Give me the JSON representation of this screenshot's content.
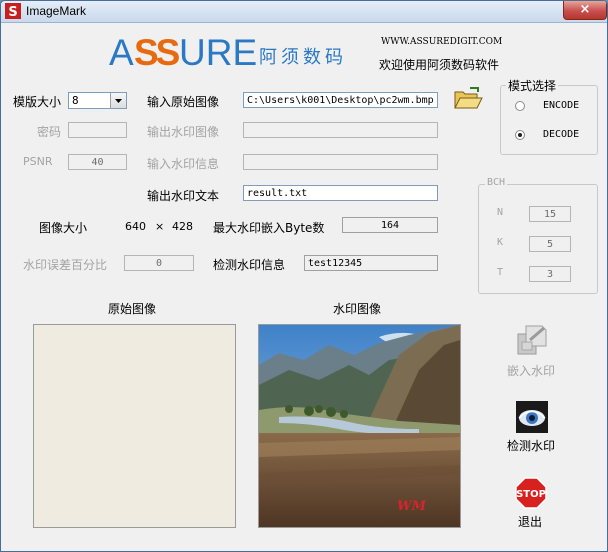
{
  "window": {
    "title": "ImageMark",
    "close_glyph": "×"
  },
  "header": {
    "logo_ass": "A",
    "logo_ss": "SS",
    "logo_ure": "URE",
    "logo_cn": "阿须数码",
    "website": "WWW.ASSUREDIGIT.COM",
    "welcome": "欢迎使用阿须数码软件"
  },
  "left": {
    "template_size_label": "模版大小",
    "template_size_value": "8",
    "password_label": "密码",
    "psnr_label": "PSNR",
    "psnr_value": "40",
    "image_size_label": "图像大小",
    "image_width": "640",
    "image_x": "×",
    "image_height": "428",
    "error_percent_label": "水印误差百分比",
    "error_percent_value": "0"
  },
  "middle": {
    "input_image_label": "输入原始图像",
    "input_image_path": "C:\\Users\\k001\\Desktop\\pc2wm.bmp",
    "output_wm_image_label": "输出水印图像",
    "input_wm_info_label": "输入水印信息",
    "output_wm_text_label": "输出水印文本",
    "output_wm_text_value": "result.txt",
    "max_embed_label": "最大水印嵌入Byte数",
    "max_embed_value": "164",
    "detected_info_label": "检测水印信息",
    "detected_info_value": "test12345"
  },
  "mode": {
    "title": "模式选择",
    "encode": "ENCODE",
    "decode": "DECODE",
    "selected": "DECODE"
  },
  "bch": {
    "title": "BCH",
    "n_label": "N",
    "n_value": "15",
    "k_label": "K",
    "k_value": "5",
    "t_label": "T",
    "t_value": "3"
  },
  "images": {
    "original_label": "原始图像",
    "watermark_label": "水印图像",
    "watermark_overlay_text": "WM"
  },
  "actions": {
    "embed_label": "嵌入水印",
    "detect_label": "检测水印",
    "exit_label": "退出",
    "stop_sign_text": "STOP"
  },
  "icons": [
    "app-icon",
    "folder-open-icon",
    "embed-icon",
    "eye-icon",
    "stop-sign-icon",
    "dropdown-arrow-icon"
  ]
}
